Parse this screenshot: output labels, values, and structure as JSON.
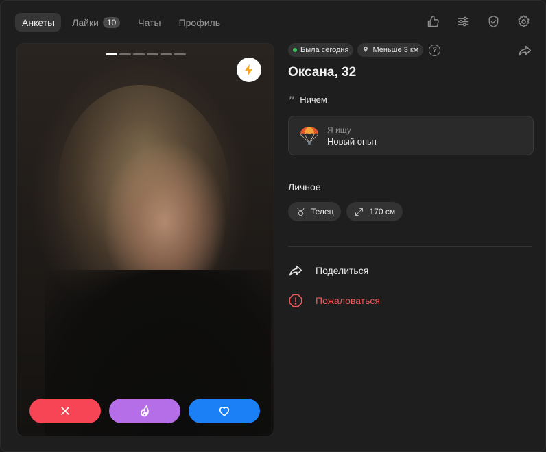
{
  "nav": {
    "tabs": [
      {
        "label": "Анкеты",
        "active": true
      },
      {
        "label": "Лайки",
        "badge": "10"
      },
      {
        "label": "Чаты"
      },
      {
        "label": "Профиль"
      }
    ],
    "icons": [
      "thumb-up-icon",
      "sliders-icon",
      "shield-check-icon",
      "gear-icon"
    ]
  },
  "photo": {
    "photo_count": 6,
    "active_index": 0,
    "boost_icon": "lightning-icon",
    "boost_color": "#f5a524"
  },
  "actions": {
    "dislike_icon": "close-icon",
    "super_icon": "flame-icon",
    "like_icon": "heart-icon",
    "dislike_color": "#f74555",
    "super_color": "#b66de8",
    "like_color": "#1b7ff5"
  },
  "profile": {
    "status": "Была сегодня",
    "distance": "Меньше 3 км",
    "help": "?",
    "name": "Оксана, 32",
    "bio": "Ничем",
    "looking_for": {
      "label": "Я ищу",
      "value": "Новый опыт",
      "icon": "parachute-icon"
    },
    "personal_title": "Личное",
    "personal": [
      {
        "icon": "taurus-icon",
        "label": "Телец"
      },
      {
        "icon": "height-icon",
        "label": "170 см"
      }
    ]
  },
  "menu": {
    "share": "Поделиться",
    "report": "Пожаловаться",
    "report_color": "#f05a5a"
  }
}
